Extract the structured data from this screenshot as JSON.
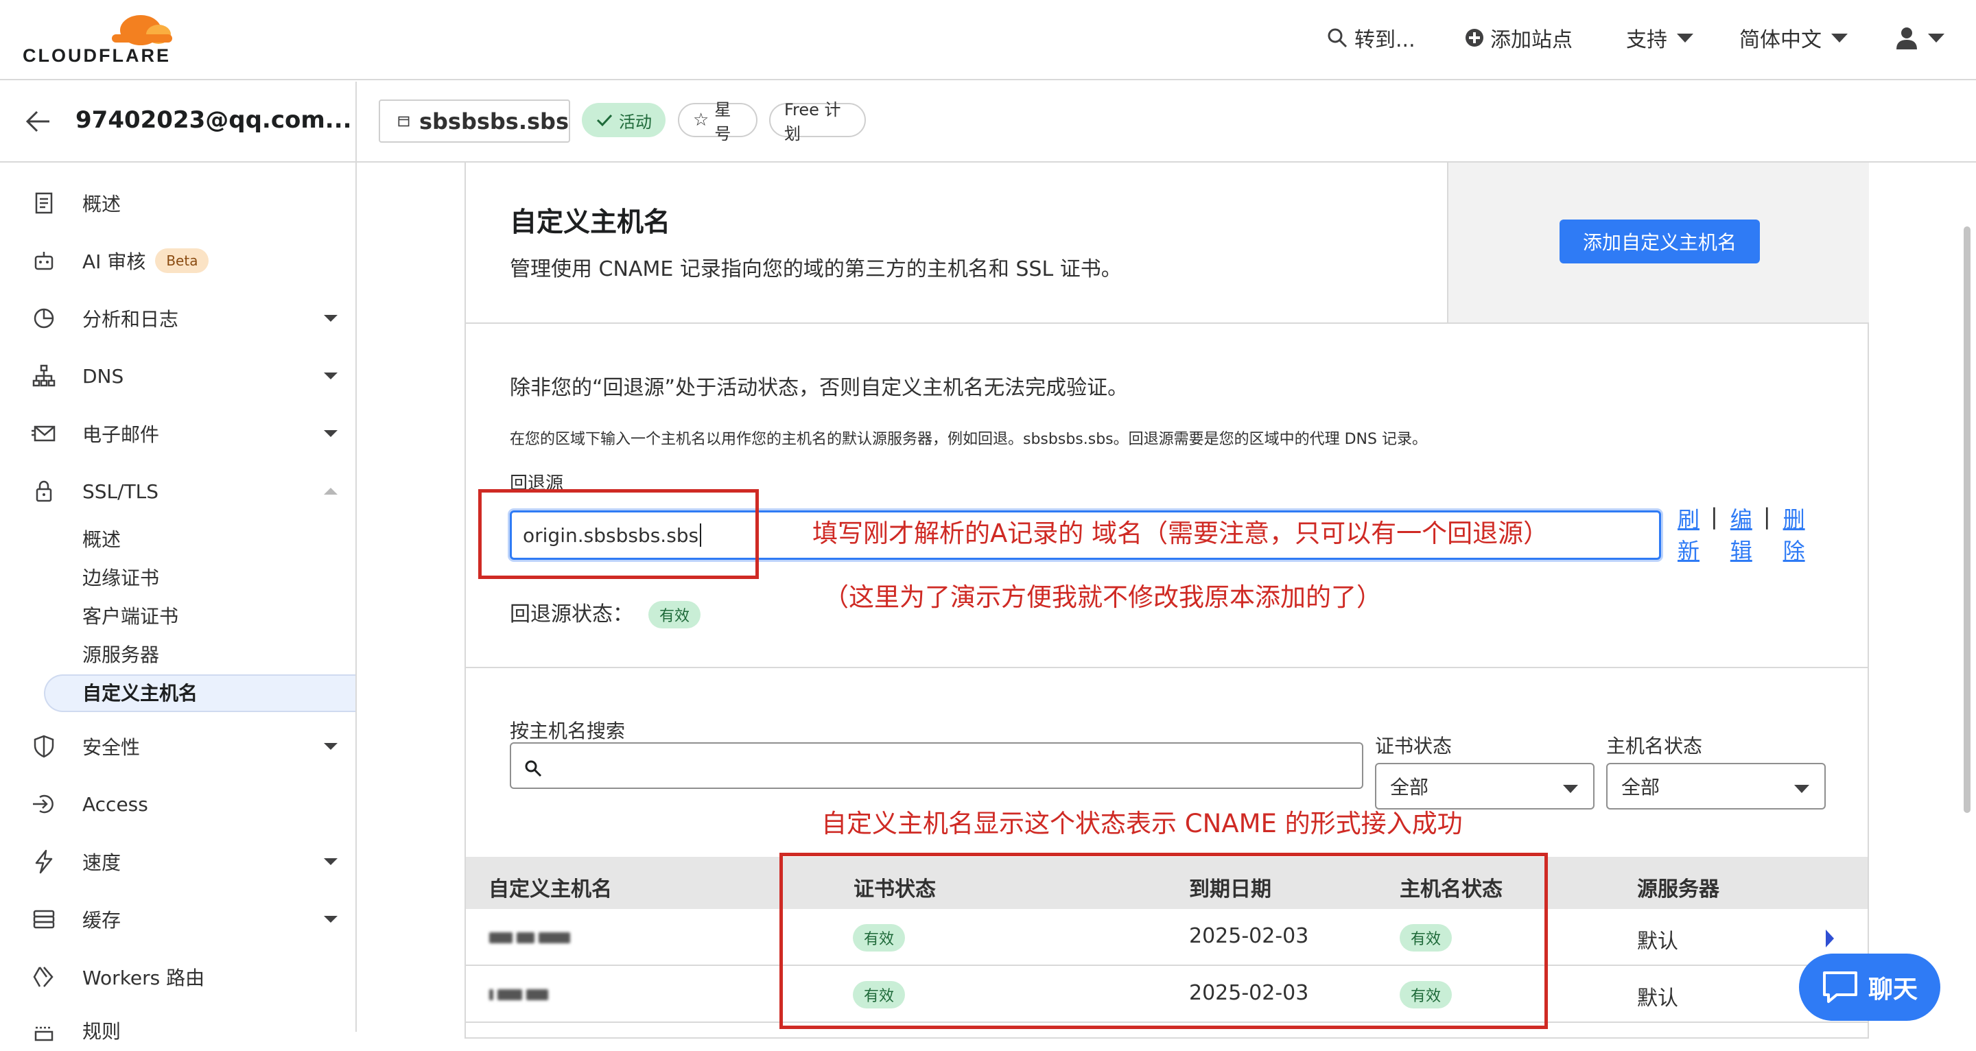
{
  "topbar": {
    "logo_text": "CLOUDFLARE",
    "goto_label": "转到...",
    "add_site_label": "添加站点",
    "support_label": "支持",
    "language_label": "简体中文"
  },
  "account": {
    "email": "97402023@qq.com..."
  },
  "zone": {
    "domain": "sbsbsbs.sbs",
    "status_pill": "活动",
    "star_pill": "星号",
    "plan_pill": "Free 计划"
  },
  "sidebar": {
    "items": [
      {
        "label": "概述",
        "icon": "document-icon"
      },
      {
        "label": "AI 审核",
        "icon": "robot-icon",
        "badge": "Beta"
      },
      {
        "label": "分析和日志",
        "icon": "pie-chart-icon"
      },
      {
        "label": "DNS",
        "icon": "network-icon"
      },
      {
        "label": "电子邮件",
        "icon": "envelope-icon"
      },
      {
        "label": "SSL/TLS",
        "icon": "lock-icon"
      },
      {
        "label": "安全性",
        "icon": "shield-icon"
      },
      {
        "label": "Access",
        "icon": "access-icon"
      },
      {
        "label": "速度",
        "icon": "lightning-icon"
      },
      {
        "label": "缓存",
        "icon": "storage-icon"
      },
      {
        "label": "Workers 路由",
        "icon": "workers-icon"
      },
      {
        "label": "规则",
        "icon": "rules-icon"
      }
    ],
    "ssl_subitems": [
      "概述",
      "边缘证书",
      "客户端证书",
      "源服务器",
      "自定义主机名"
    ]
  },
  "header": {
    "title": "自定义主机名",
    "description": "管理使用 CNAME 记录指向您的域的第三方的主机名和 SSL 证书。",
    "add_button": "添加自定义主机名"
  },
  "fallback": {
    "notice": "除非您的“回退源”处于活动状态，否则自定义主机名无法完成验证。",
    "help": "在您的区域下输入一个主机名以用作您的主机名的默认源服务器，例如回退。sbsbsbs.sbs。回退源需要是您的区域中的代理 DNS 记录。",
    "label": "回退源",
    "value": "origin.sbsbsbs.sbs",
    "refresh_line1": "刷",
    "refresh_line2": "新",
    "edit_line1": "编",
    "edit_line2": "辑",
    "delete_line1": "删",
    "delete_line2": "除",
    "status_label": "回退源状态：",
    "status_value": "有效"
  },
  "filters": {
    "search_label": "按主机名搜索",
    "search_placeholder": "",
    "cert_status_label": "证书状态",
    "cert_status_value": "全部",
    "host_status_label": "主机名状态",
    "host_status_value": "全部"
  },
  "table": {
    "columns": [
      "自定义主机名",
      "证书状态",
      "到期日期",
      "主机名状态",
      "源服务器"
    ],
    "rows": [
      {
        "cert_status": "有效",
        "expiry": "2025-02-03",
        "host_status": "有效",
        "origin": "默认"
      },
      {
        "cert_status": "有效",
        "expiry": "2025-02-03",
        "host_status": "有效",
        "origin": "默认"
      }
    ]
  },
  "annotations": {
    "note1": "填写刚才解析的A记录的 域名（需要注意，只可以有一个回退源）",
    "note2": "（这里为了演示方便我就不修改我原本添加的了）",
    "note3": "自定义主机名显示这个状态表示 CNAME 的形式接入成功"
  },
  "chat": {
    "label": "聊天"
  },
  "colors": {
    "accent": "#2f7bf5",
    "brand_orange": "#f38020",
    "success_bg": "#c9eed6",
    "annotation_red": "#cf2a24"
  }
}
